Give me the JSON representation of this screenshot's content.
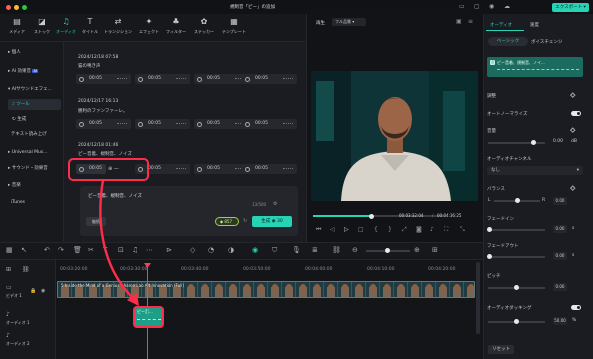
{
  "window": {
    "title": "規制音「ピー」の追加",
    "export_label": "エクスポート"
  },
  "toolbar": {
    "items": [
      {
        "label": "メディア",
        "icon": "media-icon"
      },
      {
        "label": "ストック",
        "icon": "stock-icon"
      },
      {
        "label": "オーディオ",
        "icon": "audio-note-icon"
      },
      {
        "label": "タイトル",
        "icon": "title-t-icon"
      },
      {
        "label": "トランジション",
        "icon": "transition-icon"
      },
      {
        "label": "エフェクト",
        "icon": "effect-icon"
      },
      {
        "label": "フィルター",
        "icon": "filter-icon"
      },
      {
        "label": "ステッカー",
        "icon": "sticker-icon"
      },
      {
        "label": "テンプレート",
        "icon": "template-icon"
      }
    ],
    "active": "オーディオ"
  },
  "sidebar": {
    "items": [
      {
        "label": "個人"
      },
      {
        "label": "AI 効果音"
      },
      {
        "label": "AIサウンドエフェ..."
      },
      {
        "label": "ツール"
      },
      {
        "label": "生成"
      },
      {
        "label": "テキスト読み上げ"
      },
      {
        "label": "Universal Mus..."
      },
      {
        "label": "サウンド・効果音"
      },
      {
        "label": "音楽"
      },
      {
        "label": "iTunes"
      }
    ],
    "selected": "ツール"
  },
  "library": {
    "groups": [
      {
        "date": "2024/12/18 07:58",
        "prompt": "猫の鳴き声",
        "clips": [
          "00:05",
          "00:05",
          "00:05",
          "00:05"
        ]
      },
      {
        "date": "2024/12/17 16:13",
        "prompt": "勝利のファンファーレ。",
        "clips": [
          "00:05",
          "00:05",
          "00:05",
          "00:05"
        ]
      },
      {
        "date": "2024/12/18 01:46",
        "prompt": "ピー音着、規制音、ノイズ",
        "clips": [
          "00:05",
          "00:05",
          "00:05",
          "00:05"
        ]
      }
    ],
    "prompt_box": {
      "text": "ピー音着、規制音、ノイズ",
      "counter": "13/500",
      "duration_label": "継続",
      "credits": "857",
      "generate_label": "生成",
      "generate_credits": "30"
    }
  },
  "preview": {
    "tab_label": "再生",
    "quality": "フル品質",
    "current_time": "00:03:32:04",
    "total_time": "00:04:36:25"
  },
  "right_panel": {
    "tabs": [
      "オーディオ",
      "速度"
    ],
    "subtabs": [
      "ベーシック",
      "ボイスチェンジ"
    ],
    "clip_name": "ピー音着、規制音、ノイ...",
    "sections": {
      "adjust": "調整",
      "auto_normalize": "オートノーマライズ",
      "volume": "音量",
      "volume_value": "0.00",
      "volume_unit": "dB",
      "channel": "オーディオチャンネル",
      "channel_value": "なし",
      "balance": "バランス",
      "balance_left": "L",
      "balance_right": "R",
      "balance_value": "0.00",
      "fade_in": "フェードイン",
      "fade_in_value": "0.00",
      "fade_in_unit": "s",
      "fade_out": "フェードアウト",
      "fade_out_value": "0.00",
      "fade_out_unit": "s",
      "pitch": "ピッチ",
      "pitch_value": "0.00",
      "ducking": "オーディオダッキング",
      "ducking_value": "50.00",
      "ducking_unit": "%",
      "reset_label": "リセット"
    }
  },
  "timeline": {
    "ticks": [
      "00:03:20:00",
      "00:03:30:00",
      "00:03:40:00",
      "00:03:50:00",
      "00:04:00:00",
      "00:04:10:00",
      "00:04:20:00"
    ],
    "tracks": [
      {
        "label": "ビデオ 1"
      },
      {
        "label": "オーディオ 1"
      },
      {
        "label": "オーディオ 2"
      }
    ],
    "video_clip_title": "5 Inside the Mind of a Genius - Aaron Lao Alt Innovation (Full)",
    "audio_clip_title": "ピー音..."
  },
  "colors": {
    "accent": "#27d3b5",
    "highlight": "#ff2d4a",
    "background": "#16171b"
  }
}
